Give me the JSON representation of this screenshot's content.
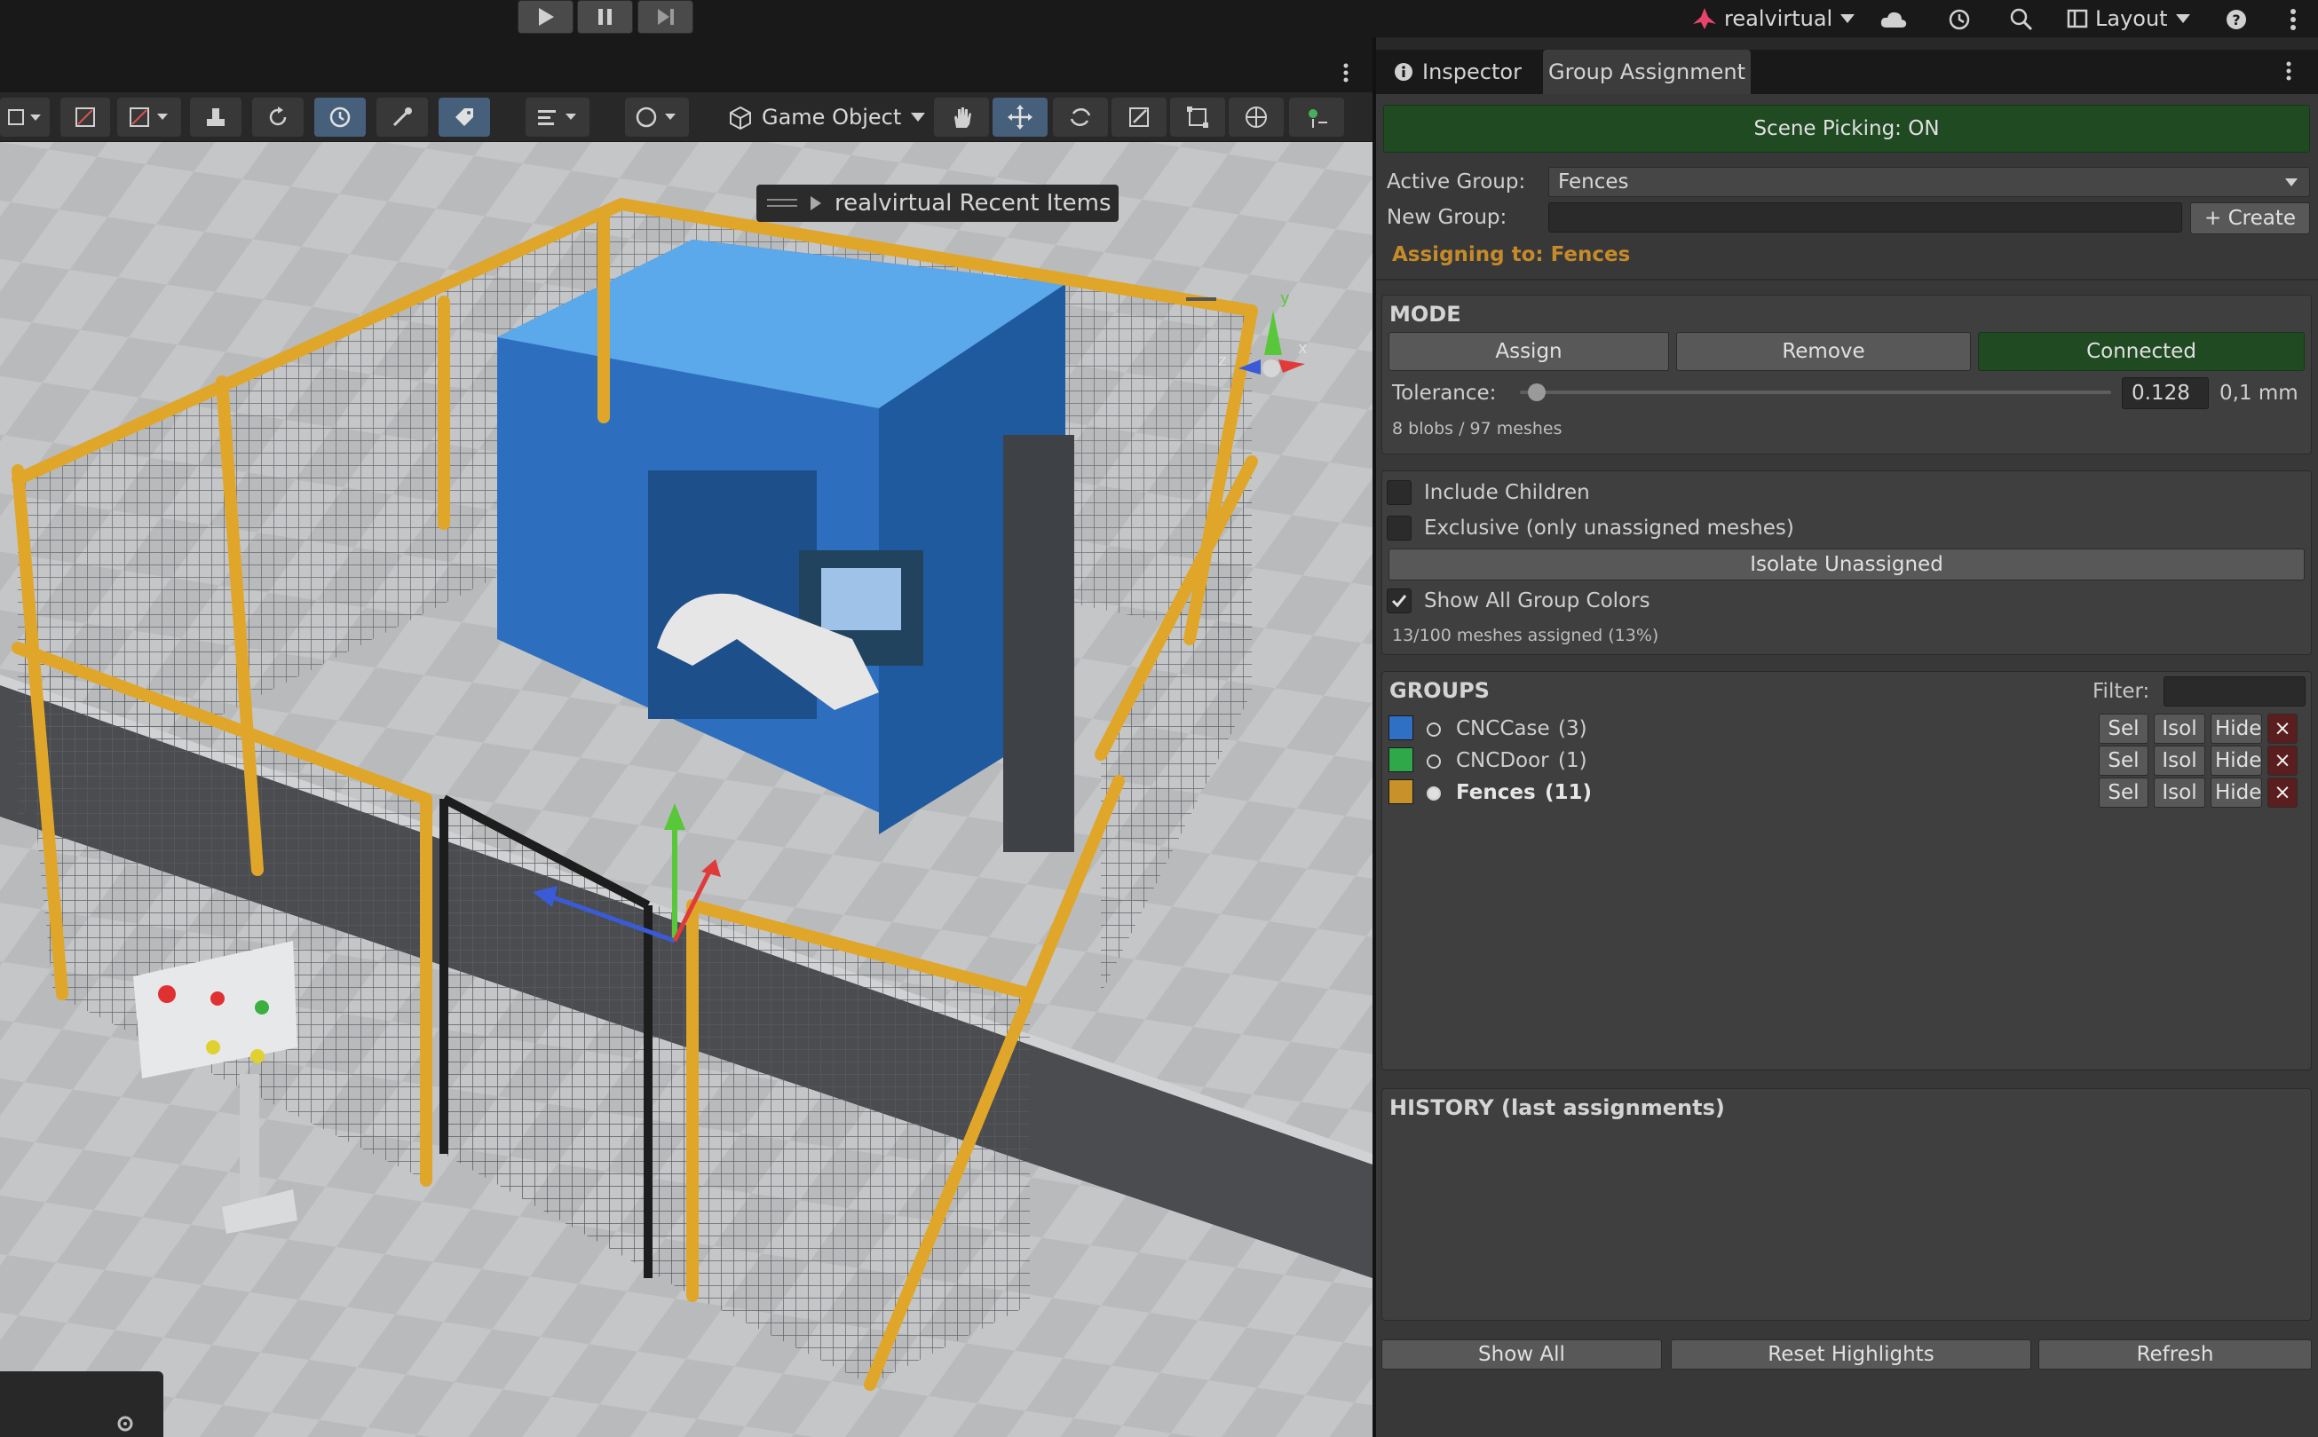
{
  "topbar": {
    "account_label": "realvirtual",
    "layout_label": "Layout",
    "icons": [
      "play-icon",
      "pause-icon",
      "step-icon",
      "cloud-icon",
      "history-icon",
      "search-icon",
      "layout-icon",
      "help-icon",
      "more-vertical-icon"
    ]
  },
  "scene_toolbar": {
    "game_object_label": "Game Object",
    "tools": [
      "select-rect-icon",
      "rotate-icon",
      "paint-icon",
      "stamp-icon",
      "refresh-icon",
      "clock-icon",
      "eyedropper-icon",
      "tag-icon",
      "settings-icon",
      "sphere-icon",
      "hand-icon",
      "move-icon",
      "rotate-tool-icon",
      "scale-icon",
      "rect-tool-icon",
      "transform-icon",
      "custom-tool-icon"
    ]
  },
  "viewport": {
    "recent_items_label": "realvirtual Recent Items",
    "gizmo_axes": [
      "y",
      "x",
      "z"
    ]
  },
  "inspector": {
    "tabs": [
      {
        "label": "Inspector",
        "icon": "info-icon",
        "active": false
      },
      {
        "label": "Group Assignment",
        "active": true
      }
    ],
    "scene_picking_label": "Scene Picking: ON",
    "active_group_label": "Active Group:",
    "active_group_value": "Fences",
    "new_group_label": "New Group:",
    "new_group_value": "",
    "create_label": "+ Create",
    "assigning_to_label": "Assigning to: Fences",
    "mode": {
      "title": "MODE",
      "assign_label": "Assign",
      "remove_label": "Remove",
      "connected_label": "Connected",
      "tolerance_label": "Tolerance:",
      "tolerance_value": "0.128",
      "tolerance_slider_fraction": 0.02,
      "tolerance_unit": "0,1 mm",
      "stats": "8 blobs / 97 meshes"
    },
    "options": {
      "include_children_label": "Include Children",
      "include_children_checked": false,
      "exclusive_label": "Exclusive (only unassigned meshes)",
      "exclusive_checked": false,
      "isolate_label": "Isolate Unassigned",
      "show_colors_label": "Show All Group Colors",
      "show_colors_checked": true,
      "assigned_stats": "13/100 meshes assigned (13%)"
    },
    "groups": {
      "title": "GROUPS",
      "filter_label": "Filter:",
      "filter_value": "",
      "sel_label": "Sel",
      "isol_label": "Isol",
      "hide_label": "Hide",
      "delete_label": "×",
      "items": [
        {
          "name": "CNCCase",
          "count": "(3)",
          "color": "#2f6fc4",
          "active": false
        },
        {
          "name": "CNCDoor",
          "count": "(1)",
          "color": "#2fa84a",
          "active": false
        },
        {
          "name": "Fences",
          "count": "(11)",
          "color": "#c9912a",
          "active": true
        }
      ]
    },
    "history": {
      "title": "HISTORY (last assignments)"
    },
    "footer": {
      "show_all_label": "Show All",
      "reset_label": "Reset Highlights",
      "refresh_label": "Refresh"
    }
  }
}
